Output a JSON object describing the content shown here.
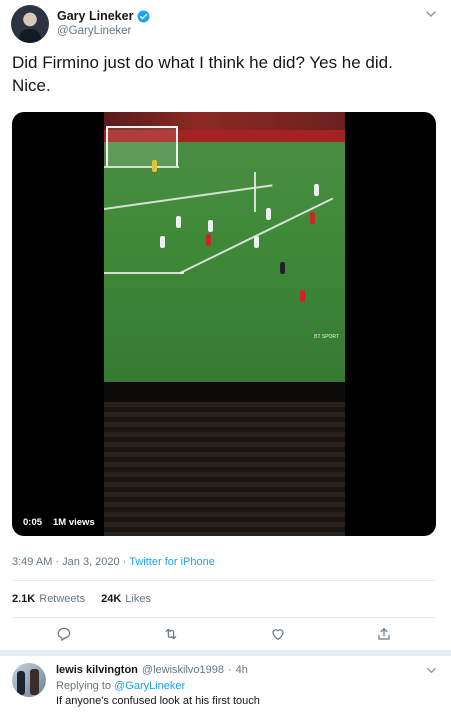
{
  "tweet": {
    "display_name": "Gary Lineker",
    "handle": "@GaryLineker",
    "verified_icon": "verified-badge-icon",
    "text_line1": "Did Firmino just do what I think he did? Yes he did.",
    "text_line2": "Nice.",
    "video": {
      "duration": "0:05",
      "views": "1M views",
      "broadcaster_bug": "BT SPORT"
    },
    "time": "3:49 AM",
    "date_sep": "·",
    "date": "Jan 3, 2020",
    "source_sep": "·",
    "source": "Twitter for iPhone",
    "retweets_count": "2.1K",
    "retweets_label": "Retweets",
    "likes_count": "24K",
    "likes_label": "Likes",
    "actions": [
      "reply-icon",
      "retweet-icon",
      "like-icon",
      "share-icon"
    ]
  },
  "reply": {
    "display_name": "lewis kilvington",
    "handle": "@lewiskilvo1998",
    "sep": "·",
    "time": "4h",
    "replying_label": "Replying to",
    "replying_to": "@GaryLineker",
    "text": "If anyone's confused look at his first touch"
  },
  "colors": {
    "accent": "#1da1f2",
    "secondary_text": "#657786",
    "primary_text": "#14171a",
    "divider": "#e6ecf0"
  }
}
